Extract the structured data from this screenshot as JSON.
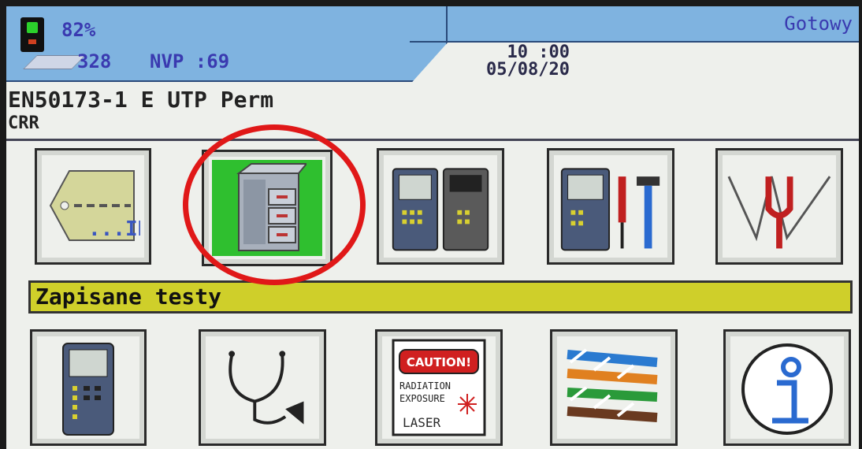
{
  "header": {
    "battery_percent": "82%",
    "storage_count": "328",
    "nvp": "NVP :69",
    "status": "Gotowy",
    "time": "10 :00",
    "date": "05/08/20"
  },
  "test_standard": "EN50173-1 E UTP Perm",
  "subtitle": "CRR",
  "selected_label": "Zapisane testy",
  "tiles_row1": [
    {
      "icon": "id-tag-icon",
      "text": "...ID"
    },
    {
      "icon": "file-cabinet-icon",
      "selected": true
    },
    {
      "icon": "tester-pair-icon"
    },
    {
      "icon": "tester-tools-icon"
    },
    {
      "icon": "tuning-fork-icon"
    }
  ],
  "tiles_row2": [
    {
      "icon": "tester-device-icon"
    },
    {
      "icon": "stethoscope-icon"
    },
    {
      "icon": "laser-caution-icon",
      "caution_text": "CAUTION!",
      "line1": "RADIATION",
      "line2": "EXPOSURE",
      "line3": "LASER"
    },
    {
      "icon": "cable-bundle-icon"
    },
    {
      "icon": "info-icon"
    }
  ]
}
